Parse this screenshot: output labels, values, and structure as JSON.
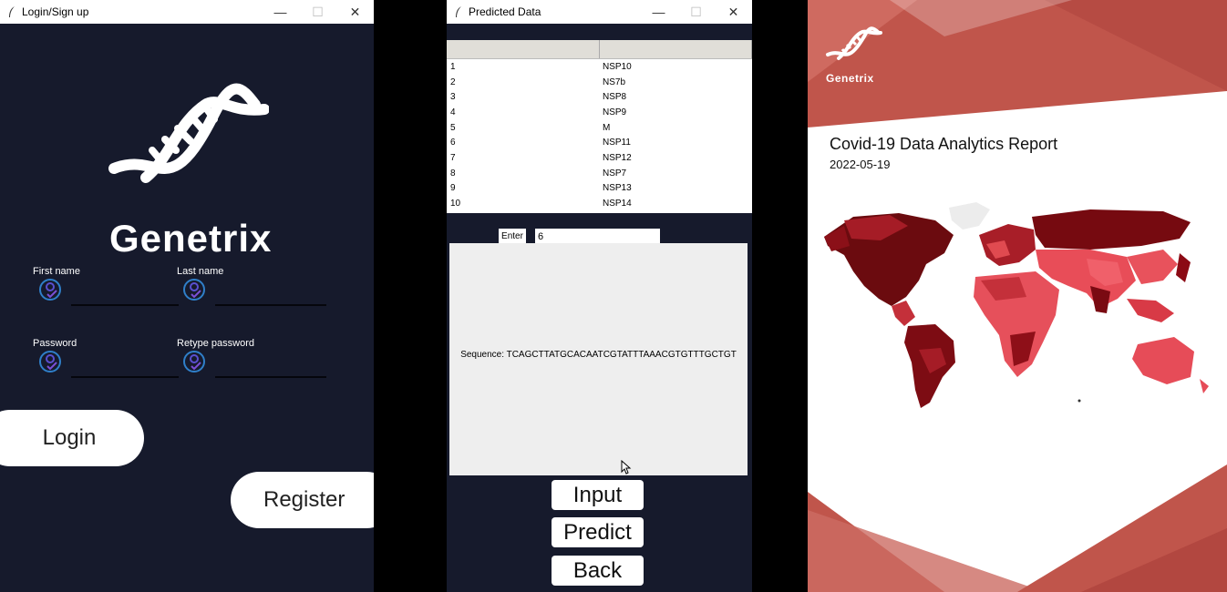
{
  "login_window": {
    "title": "Login/Sign up",
    "brand": "Genetrix",
    "fields": {
      "first_name_label": "First name",
      "last_name_label": "Last name",
      "password_label": "Password",
      "retype_password_label": "Retype password"
    },
    "login_button": "Login",
    "register_button": "Register"
  },
  "predicted_window": {
    "title": "Predicted Data",
    "table": {
      "rows": [
        {
          "index": "1",
          "value": "NSP10"
        },
        {
          "index": "2",
          "value": "NS7b"
        },
        {
          "index": "3",
          "value": "NSP8"
        },
        {
          "index": "4",
          "value": "NSP9"
        },
        {
          "index": "5",
          "value": "M"
        },
        {
          "index": "6",
          "value": "NSP11"
        },
        {
          "index": "7",
          "value": "NSP12"
        },
        {
          "index": "8",
          "value": "NSP7"
        },
        {
          "index": "9",
          "value": "NSP13"
        },
        {
          "index": "10",
          "value": "NSP14"
        }
      ]
    },
    "enter_label": "Enter",
    "enter_value": "6",
    "output_text": "Sequence: TCAGCTTATGCACAATCGTATTTAAACGTGTTTGCTGT",
    "buttons": {
      "input": "Input",
      "predict": "Predict",
      "back": "Back"
    }
  },
  "report_window": {
    "brand": "Genetrix",
    "title": "Covid-19 Data Analytics Report",
    "date": "2022-05-19"
  },
  "colors": {
    "app_bg": "#161a2c",
    "report_red": "#c0554b",
    "map_dark": "#8b0a14"
  }
}
